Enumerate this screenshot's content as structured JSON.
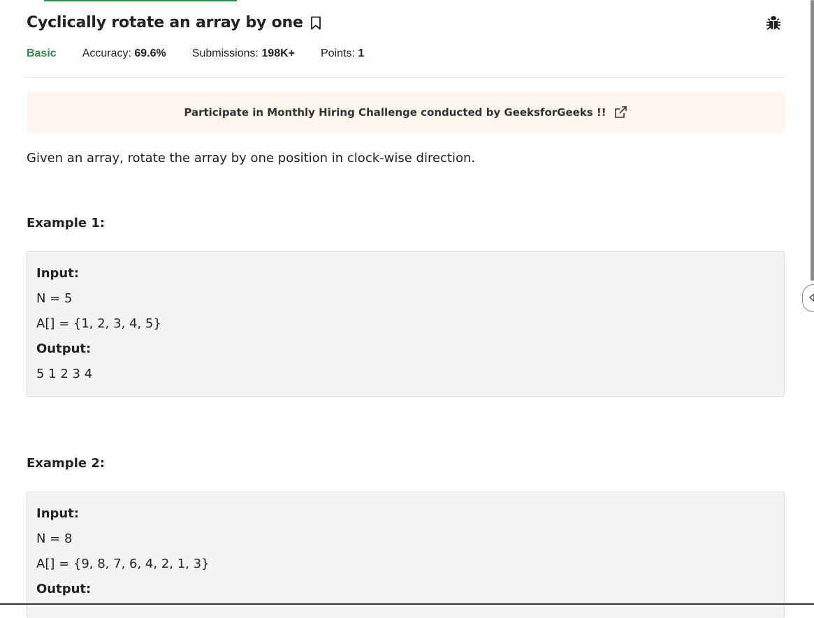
{
  "problem": {
    "title": "Cyclically rotate an array by one",
    "difficulty": "Basic",
    "accuracy_label": "Accuracy:",
    "accuracy_value": "69.6%",
    "submissions_label": "Submissions:",
    "submissions_value": "198K+",
    "points_label": "Points:",
    "points_value": "1"
  },
  "banner": {
    "text": "Participate in Monthly Hiring Challenge conducted by GeeksforGeeks !!"
  },
  "description": "Given an array, rotate the array by one position in clock-wise direction.",
  "examples": [
    {
      "heading": "Example 1:",
      "input_label": "Input:",
      "input_lines": [
        "N = 5",
        "A[] = {1, 2, 3, 4, 5}"
      ],
      "output_label": "Output:",
      "output_value": "5 1 2 3 4"
    },
    {
      "heading": "Example 2:",
      "input_label": "Input:",
      "input_lines": [
        "N = 8",
        "A[] = {9, 8, 7, 6, 4, 2, 1, 3}"
      ],
      "output_label": "Output:"
    }
  ],
  "icons": {
    "bookmark": "bookmark-icon",
    "bug": "bug-icon",
    "external_link": "external-link-icon",
    "side_toggle": "chevron-left-icon"
  },
  "colors": {
    "difficulty": "#2f8d46",
    "banner_bg": "#fff6ed",
    "example_bg": "#f4f4f4"
  }
}
